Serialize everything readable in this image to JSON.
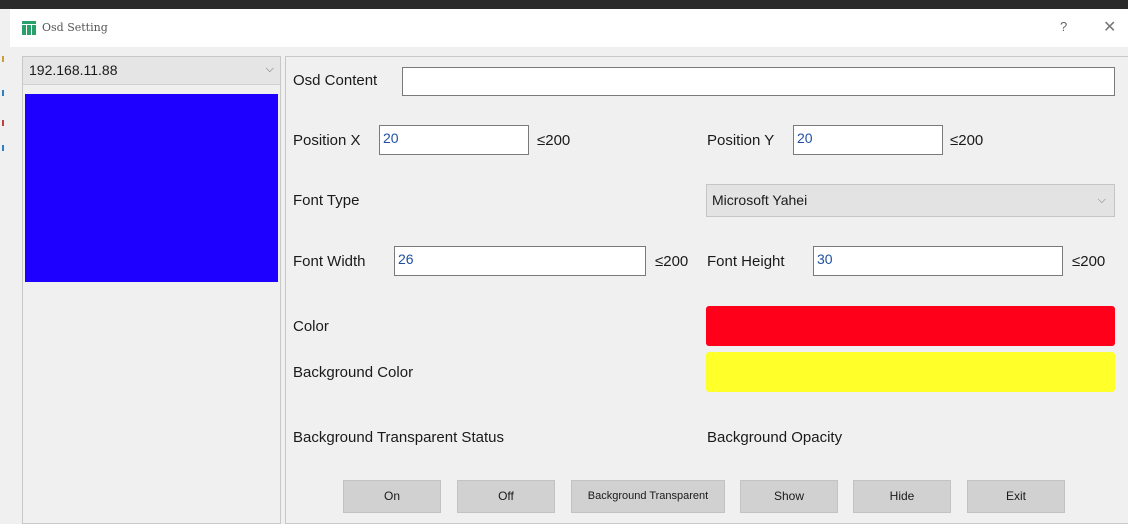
{
  "window": {
    "title": "Osd Setting",
    "help_glyph": "?",
    "close_glyph": "✕"
  },
  "left": {
    "device_ip": "192.168.11.88",
    "preview_color": "#1d00ff"
  },
  "form": {
    "osd_content_label": "Osd Content",
    "osd_content_value": "",
    "position_x_label": "Position X",
    "position_x_value": "20",
    "position_x_max": "≤200",
    "position_y_label": "Position Y",
    "position_y_value": "20",
    "position_y_max": "≤200",
    "font_type_label": "Font Type",
    "font_type_value": "Microsoft Yahei",
    "font_width_label": "Font Width",
    "font_width_value": "26",
    "font_width_max": "≤200",
    "font_height_label": "Font Height",
    "font_height_value": "30",
    "font_height_max": "≤200",
    "color_label": "Color",
    "color_value": "#ff001a",
    "bg_color_label": "Background Color",
    "bg_color_value": "#ffff2a",
    "bg_transparent_status_label": "Background Transparent Status",
    "bg_opacity_label": "Background Opacity"
  },
  "buttons": {
    "on": "On",
    "off": "Off",
    "bg_transparent": "Background Transparent",
    "show": "Show",
    "hide": "Hide",
    "exit": "Exit"
  }
}
